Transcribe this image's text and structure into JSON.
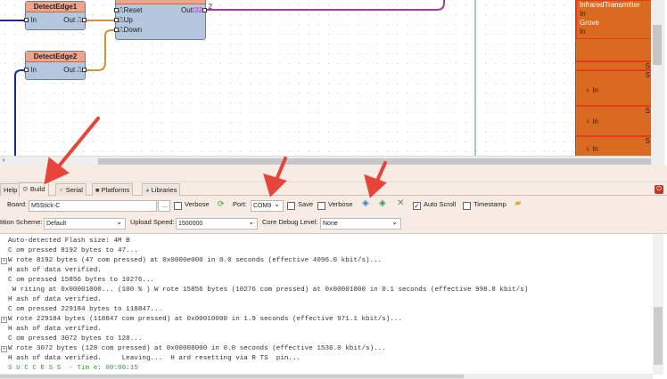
{
  "canvas": {
    "components": [
      {
        "title": "DetectEdge1",
        "in": "In",
        "out": "Out"
      },
      {
        "title": "DetectEdge2",
        "in": "In",
        "out": "Out"
      },
      {
        "title": "",
        "pins": [
          "Reset",
          "Up",
          "Down"
        ],
        "out": "Out",
        "out_type": "I32",
        "wire_label": "2"
      }
    ],
    "right_panel": {
      "items": [
        "InfraredTransmitter",
        "In",
        "Grove",
        "In",
        "S",
        "S",
        "In",
        "S",
        "In",
        "S",
        "In"
      ]
    }
  },
  "tabs": [
    {
      "label": "Help"
    },
    {
      "label": "Build"
    },
    {
      "label": "Serial"
    },
    {
      "label": "Platforms"
    },
    {
      "label": "Libraries"
    }
  ],
  "build": {
    "board_label": "Board:",
    "board_value": "M5Stick-C",
    "browse": "...",
    "verbose1": "Verbose",
    "port_label": "Port:",
    "port_value": "COM9",
    "save": "Save",
    "verbose2": "Verbose",
    "auto_scroll": "Auto Scroll",
    "timestamp": "Timestamp",
    "partition_label": "tition Scheme:",
    "partition_value": "Default",
    "upload_label": "Upload Speed:",
    "upload_value": "1500000",
    "debug_label": "Core Debug Level:",
    "debug_value": "None"
  },
  "output": {
    "lines": [
      {
        "text": "Auto-detected Flash size: 4M B",
        "plus": false
      },
      {
        "text": "C om pressed 8192 bytes to 47...",
        "plus": false
      },
      {
        "text": "W rote 8192 bytes (47 com pressed) at 0x0000e000 in 0.0 seconds (effective 4096.0 kbit/s)...",
        "plus": true
      },
      {
        "text": "H ash of data verified.",
        "plus": false
      },
      {
        "text": "C om pressed 15856 bytes to 10276...",
        "plus": false
      },
      {
        "text": " W riting at 0x00001000... (100 % ) W rote 15856 bytes (10276 com pressed) at 0x00001000 in 0.1 seconds (effective 998.8 kbit/s)",
        "plus": false
      },
      {
        "text": "H ash of data verified.",
        "plus": false
      },
      {
        "text": "C om pressed 229184 bytes to 118847...",
        "plus": false
      },
      {
        "text": "W rote 229184 bytes (118847 com pressed) at 0x00010000 in 1.9 seconds (effective 971.1 kbit/s)...",
        "plus": true
      },
      {
        "text": "H ash of data verified.",
        "plus": false
      },
      {
        "text": "C om pressed 3072 bytes to 128...",
        "plus": false
      },
      {
        "text": "W rote 3072 bytes (128 com pressed) at 0x00008000 in 0.0 seconds (effective 1536.0 kbit/s)...",
        "plus": true
      },
      {
        "text": "H ash of data verified.     Leaving...  H ard resetting via R TS  pin...",
        "plus": false
      },
      {
        "text": "S U C C E S S  - Tim e: 00:00:15",
        "plus": false,
        "success": true
      }
    ]
  },
  "colors": {
    "success": "#3a9a3a",
    "arrow": "#e8453a",
    "orange": "#d96a1f"
  }
}
